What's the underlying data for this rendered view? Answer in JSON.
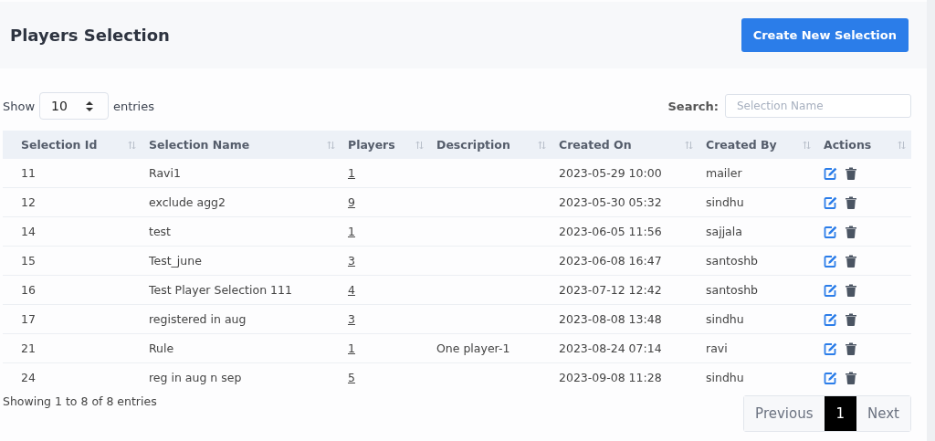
{
  "header": {
    "title": "Players Selection",
    "button": "Create New Selection"
  },
  "length": {
    "label_before": "Show",
    "value": "10",
    "label_after": "entries"
  },
  "search": {
    "label": "Search:",
    "placeholder": "Selection Name"
  },
  "table": {
    "columns": [
      "Selection Id",
      "Selection Name",
      "Players",
      "Description",
      "Created On",
      "Created By",
      "Actions"
    ],
    "rows": [
      {
        "id": "11",
        "name": "Ravi1",
        "players": "1",
        "description": "",
        "created_on": "2023-05-29 10:00",
        "created_by": "mailer"
      },
      {
        "id": "12",
        "name": "exclude agg2",
        "players": "9",
        "description": "",
        "created_on": "2023-05-30 05:32",
        "created_by": "sindhu"
      },
      {
        "id": "14",
        "name": "test",
        "players": "1",
        "description": "",
        "created_on": "2023-06-05 11:56",
        "created_by": "sajjala"
      },
      {
        "id": "15",
        "name": "Test_june",
        "players": "3",
        "description": "",
        "created_on": "2023-06-08 16:47",
        "created_by": "santoshb"
      },
      {
        "id": "16",
        "name": "Test Player Selection 111",
        "players": "4",
        "description": "",
        "created_on": "2023-07-12 12:42",
        "created_by": "santoshb"
      },
      {
        "id": "17",
        "name": "registered in aug",
        "players": "3",
        "description": "",
        "created_on": "2023-08-08 13:48",
        "created_by": "sindhu"
      },
      {
        "id": "21",
        "name": "Rule",
        "players": "1",
        "description": "One player-1",
        "created_on": "2023-08-24 07:14",
        "created_by": "ravi"
      },
      {
        "id": "24",
        "name": "reg in aug n sep",
        "players": "5",
        "description": "",
        "created_on": "2023-09-08 11:28",
        "created_by": "sindhu"
      }
    ]
  },
  "info": "Showing 1 to 8 of 8 entries",
  "pagination": [
    {
      "label": "Previous",
      "selected": false
    },
    {
      "label": "1",
      "selected": true
    },
    {
      "label": "Next",
      "selected": false
    }
  ]
}
